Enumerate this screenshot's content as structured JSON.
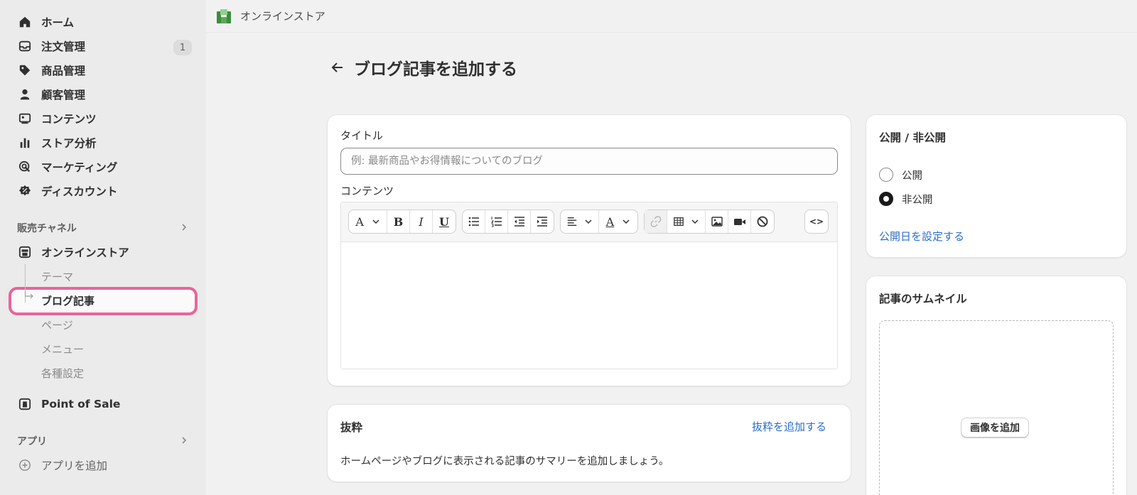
{
  "sidebar": {
    "items": [
      {
        "label": "ホーム",
        "icon": "home-icon"
      },
      {
        "label": "注文管理",
        "icon": "inbox-icon",
        "badge": "1"
      },
      {
        "label": "商品管理",
        "icon": "tag-icon"
      },
      {
        "label": "顧客管理",
        "icon": "person-icon"
      },
      {
        "label": "コンテンツ",
        "icon": "content-icon"
      },
      {
        "label": "ストア分析",
        "icon": "bar-chart-icon"
      },
      {
        "label": "マーケティング",
        "icon": "target-icon"
      },
      {
        "label": "ディスカウント",
        "icon": "discount-icon"
      }
    ],
    "sales_channels": {
      "title": "販売チャネル",
      "store": "オンラインストア",
      "sub_items": [
        "テーマ",
        "ブログ記事",
        "ページ",
        "メニュー",
        "各種設定"
      ],
      "pos": "Point of Sale"
    },
    "apps": {
      "title": "アプリ",
      "add": "アプリを追加"
    }
  },
  "topbar": {
    "store_label": "オンラインストア"
  },
  "page": {
    "title": "ブログ記事を追加する"
  },
  "editor_card": {
    "title_label": "タイトル",
    "title_placeholder": "例: 最新商品やお得情報についてのブログ",
    "content_label": "コンテンツ",
    "toolbar": {
      "font": "A",
      "bold": "B",
      "italic": "I",
      "underline": "U",
      "color": "A",
      "source": "<>"
    }
  },
  "excerpt_card": {
    "title": "抜粋",
    "link": "抜粋を追加する",
    "description": "ホームページやブログに表示される記事のサマリーを追加しましょう。"
  },
  "visibility_card": {
    "title": "公開 / 非公開",
    "options": [
      {
        "label": "公開",
        "checked": false
      },
      {
        "label": "非公開",
        "checked": true
      }
    ],
    "link": "公開日を設定する"
  },
  "thumbnail_card": {
    "title": "記事のサムネイル",
    "button": "画像を追加"
  },
  "colors": {
    "accent": "#2c6ecb",
    "highlight": "#e8659a",
    "sidebar_bg": "#ebebeb",
    "page_bg": "#f1f1f1"
  }
}
